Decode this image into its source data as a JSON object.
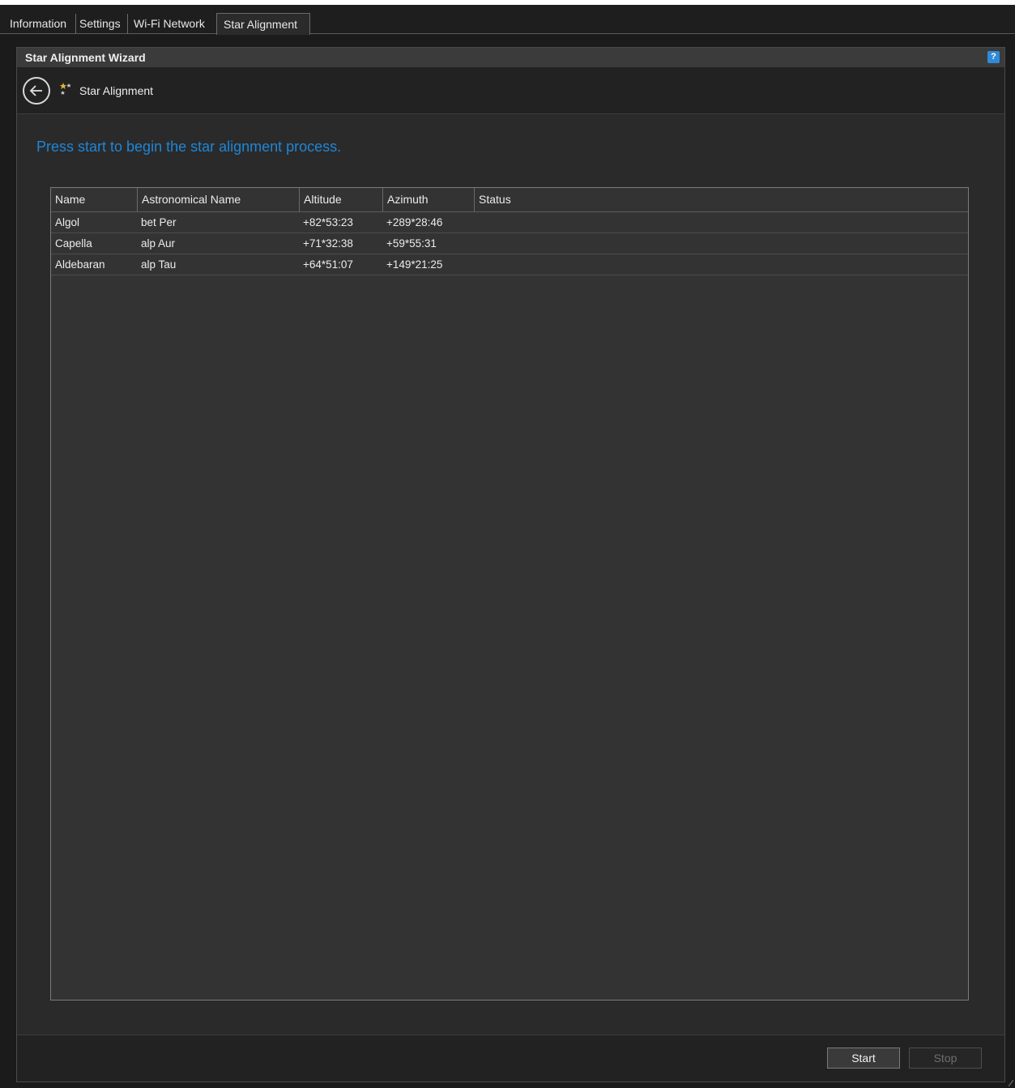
{
  "tabs": [
    {
      "label": "Information"
    },
    {
      "label": "Settings"
    },
    {
      "label": "Wi-Fi Network"
    },
    {
      "label": "Star Alignment",
      "active": true
    }
  ],
  "panel": {
    "title": "Star Alignment Wizard",
    "help_icon": "help-icon",
    "help_glyph": "?"
  },
  "wizard": {
    "back_icon": "back-arrow-icon",
    "step_icon": "stars-icon",
    "step_title": "Star Alignment"
  },
  "instruction": "Press start to begin the star alignment process.",
  "colors": {
    "accent": "#1f86d6",
    "background": "#2a2a2a",
    "star_gold": "#e0b43a"
  },
  "table": {
    "columns": [
      "Name",
      "Astronomical Name",
      "Altitude",
      "Azimuth",
      "Status"
    ],
    "rows": [
      {
        "name": "Algol",
        "astro": "bet Per",
        "altitude": "+82*53:23",
        "azimuth": "+289*28:46",
        "status": ""
      },
      {
        "name": "Capella",
        "astro": "alp Aur",
        "altitude": "+71*32:38",
        "azimuth": "+59*55:31",
        "status": ""
      },
      {
        "name": "Aldebaran",
        "astro": "alp Tau",
        "altitude": "+64*51:07",
        "azimuth": "+149*21:25",
        "status": ""
      }
    ]
  },
  "buttons": {
    "start": "Start",
    "stop": "Stop"
  }
}
